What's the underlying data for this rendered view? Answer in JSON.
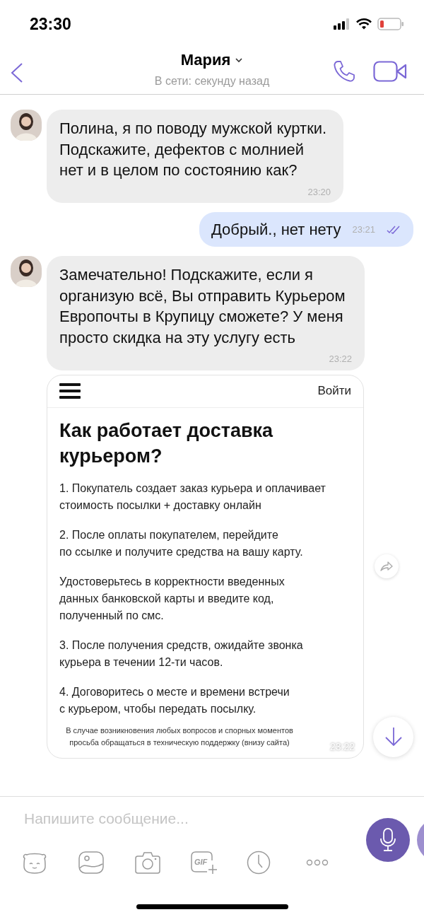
{
  "status_bar": {
    "time": "23:30"
  },
  "header": {
    "name": "Мария",
    "status": "В сети: секунду назад"
  },
  "messages": [
    {
      "kind": "incoming",
      "text": "Полина, я по поводу мужской куртки. Подскажите, дефектов с молнией нет и в целом по состоянию как?",
      "time": "23:20"
    },
    {
      "kind": "outgoing",
      "text": "Добрый., нет нету",
      "time": "23:21",
      "read": true
    },
    {
      "kind": "incoming",
      "text": "Замечательно! Подскажите, если я организую всё, Вы отправить Курьером Европочты в Крупицу сможете? У меня просто скидка на эту услугу есть",
      "time": "23:22"
    },
    {
      "kind": "image",
      "login": "Войти",
      "heading": "Как работает доставка курьером?",
      "paragraphs": [
        [
          "1. Покупатель создает заказ курьера и оплачивает",
          "стоимость посылки + доставку онлайн"
        ],
        [
          "2. После оплаты покупателем, перейдите",
          "по ссылке  и получите средства на вашу карту."
        ],
        [
          "Удостоверьтесь в корректности введенных",
          "данных банковской карты и введите код,",
          "полученный по смс."
        ],
        [
          "3. После получения средств, ожидайте звонка",
          "курьера в течении 12-ти часов."
        ],
        [
          "4. Договоритесь о месте и времени встречи",
          "с курьером, чтобы передать посылку."
        ]
      ],
      "footnote": [
        "В случае возникновения любых вопросов и спорных моментов",
        "просьба обращаться в техническую поддержку (внизу сайта)"
      ],
      "time": "23:22"
    }
  ],
  "composer": {
    "placeholder": "Напишите сообщение...",
    "gif_label": "GIF"
  }
}
